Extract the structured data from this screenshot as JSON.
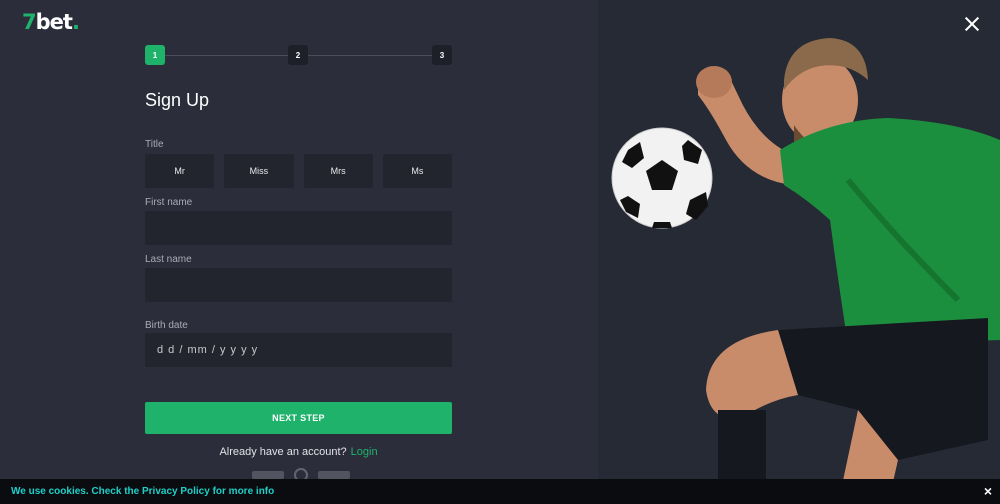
{
  "brand": {
    "logo_prefix": "7",
    "logo_main": "bet",
    "logo_dot": ".",
    "accent": "#1fb26b"
  },
  "stepper": {
    "steps": [
      "1",
      "2",
      "3"
    ],
    "active": 1
  },
  "form": {
    "heading": "Sign Up",
    "title_label": "Title",
    "title_options": [
      "Mr",
      "Miss",
      "Mrs",
      "Ms"
    ],
    "first_name_label": "First name",
    "first_name_value": "",
    "last_name_label": "Last name",
    "last_name_value": "",
    "birth_label": "Birth date",
    "birth_placeholder": "d d  / mm / y y y y",
    "next_label": "NEXT STEP",
    "account_prompt": "Already have an account?",
    "login_label": "Login"
  },
  "cookie": {
    "text": "We use cookies. Check the Privacy Policy for more info",
    "close": "×"
  },
  "icons": {
    "close": "close-icon",
    "ball": "soccer-ball-icon"
  }
}
